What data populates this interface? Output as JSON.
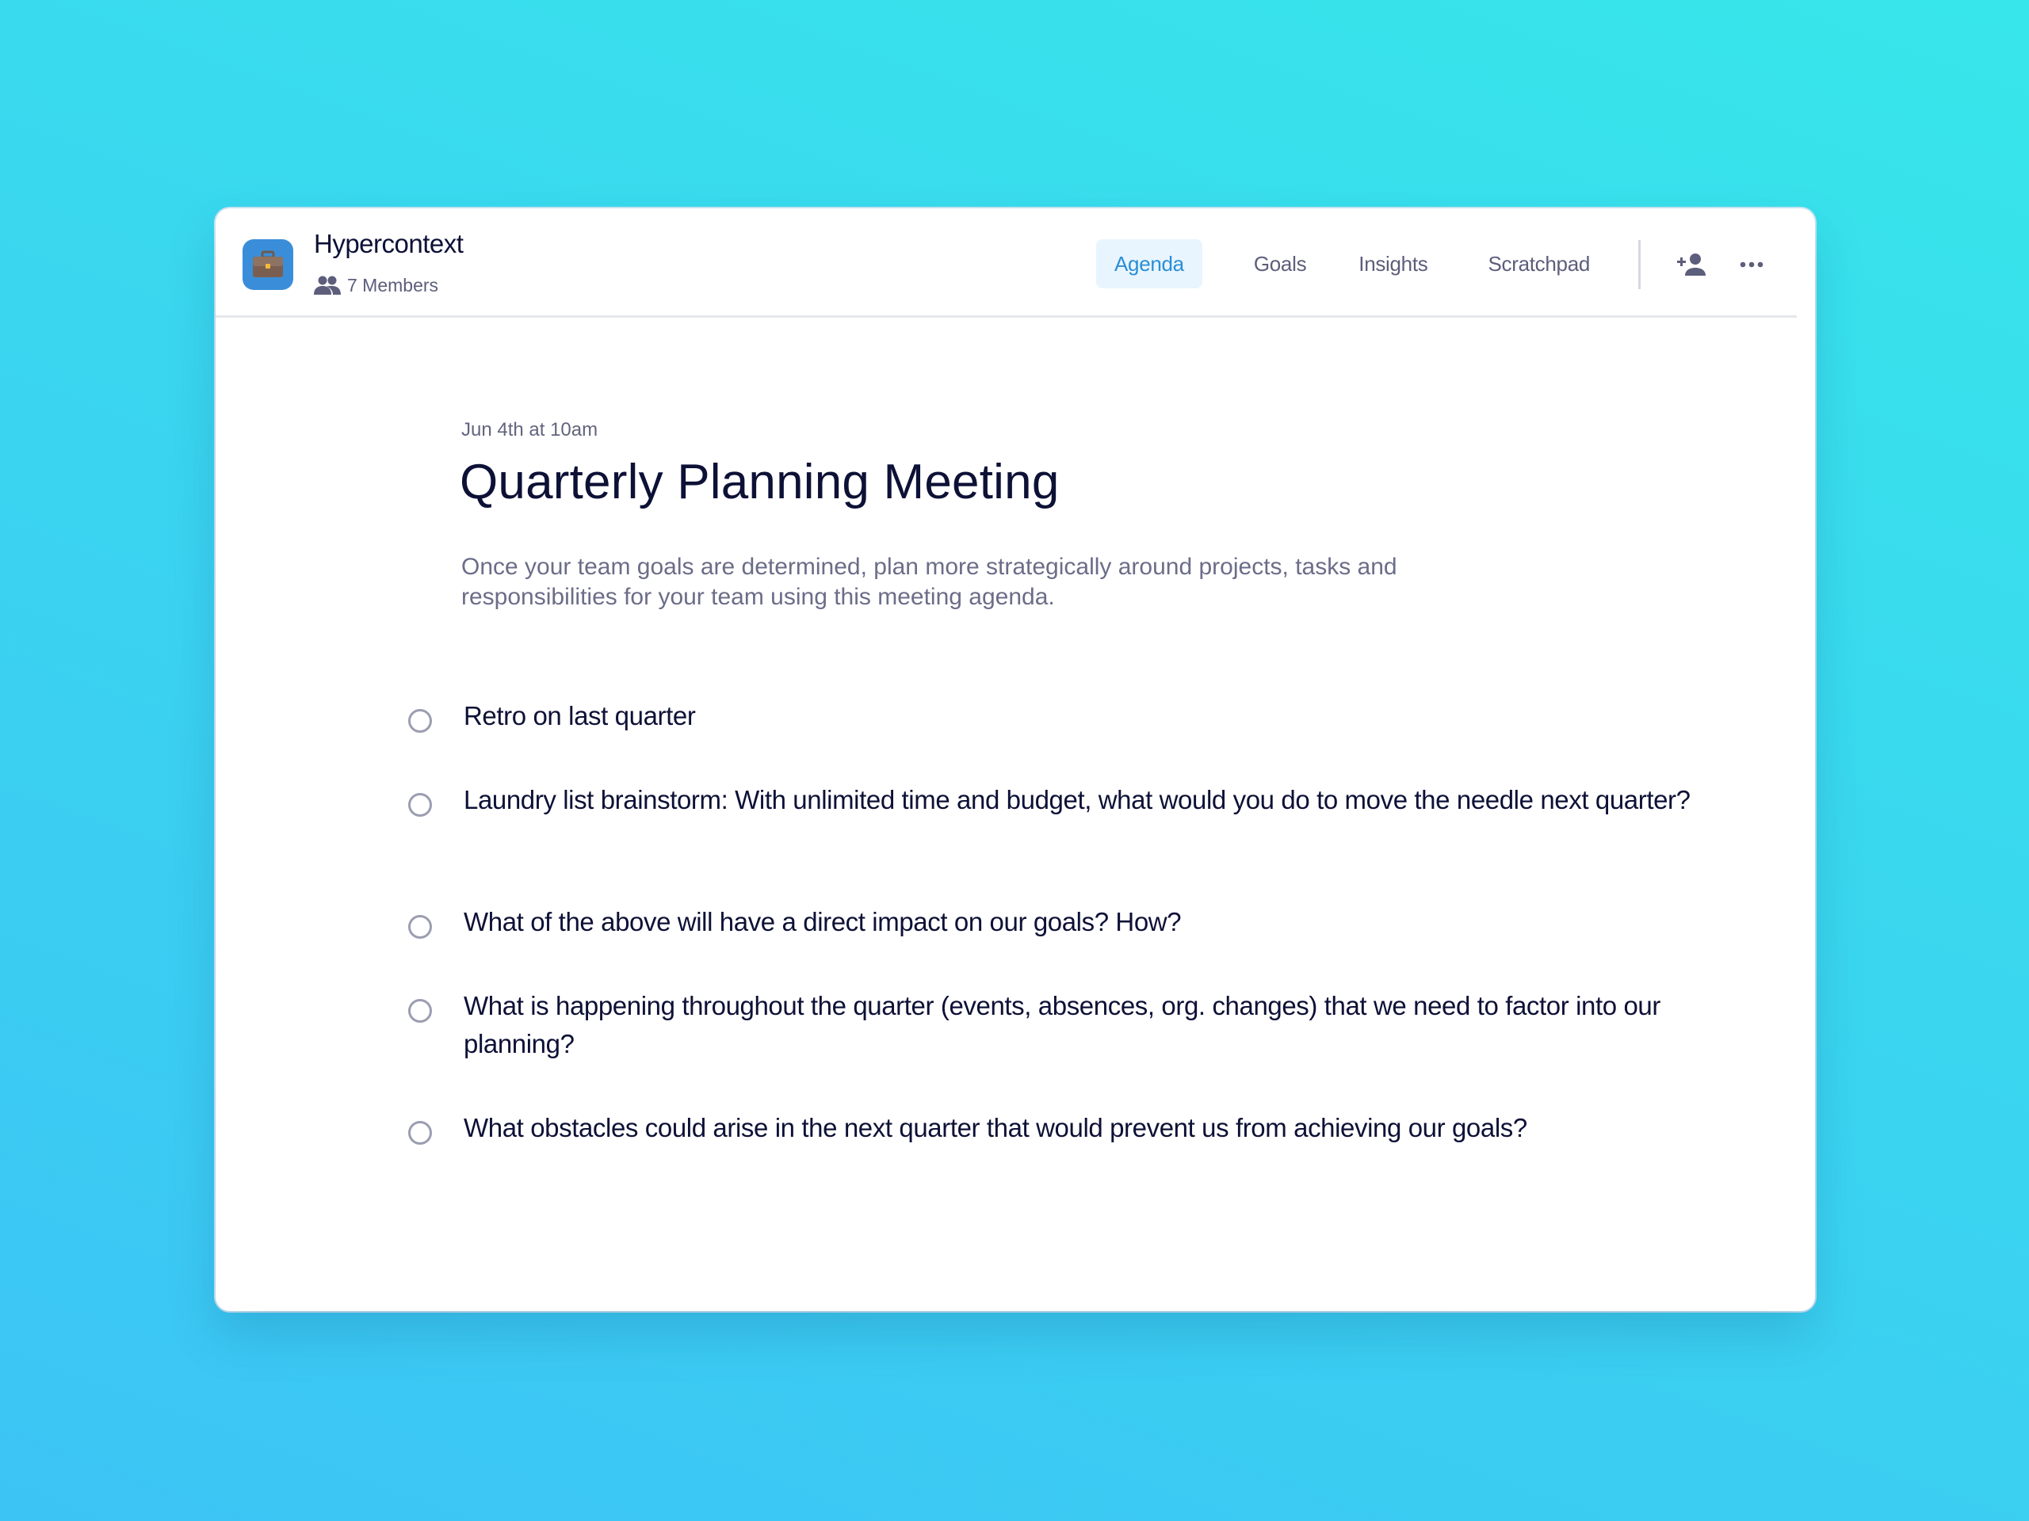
{
  "workspace": {
    "name": "Hypercontext",
    "members_label": "7 Members",
    "icon": "briefcase-icon",
    "icon_bg_color": "#3a8ed9"
  },
  "nav": {
    "tabs": [
      {
        "label": "Agenda",
        "active": true
      },
      {
        "label": "Goals",
        "active": false
      },
      {
        "label": "Insights",
        "active": false
      },
      {
        "label": "Scratchpad",
        "active": false
      }
    ],
    "actions": [
      {
        "name": "add-member",
        "icon": "person-add-icon"
      },
      {
        "name": "more",
        "icon": "more-horizontal-icon"
      }
    ]
  },
  "meeting": {
    "date": "Jun 4th at 10am",
    "title": "Quarterly Planning Meeting",
    "description": "Once your team goals are determined, plan more strategically around projects, tasks and responsibilities for your team using this meeting agenda."
  },
  "agenda": {
    "items": [
      {
        "text": "Retro on last quarter",
        "done": false
      },
      {
        "text": "Laundry list brainstorm: With unlimited time and budget, what would you do to move the needle next quarter?",
        "done": false
      },
      {
        "text": "What of the above will have a direct impact on our goals? How?",
        "done": false
      },
      {
        "text": "What is happening throughout the quarter (events, absences, org. changes) that we need to factor into our planning?",
        "done": false
      },
      {
        "text": "What obstacles could arise in the next quarter that would prevent us from achieving our goals?",
        "done": false
      }
    ]
  },
  "colors": {
    "accent": "#2a8ed6",
    "active_tab_bg": "#e8f5fe",
    "text_primary": "#0d1136",
    "text_secondary": "#5c5e7b"
  }
}
